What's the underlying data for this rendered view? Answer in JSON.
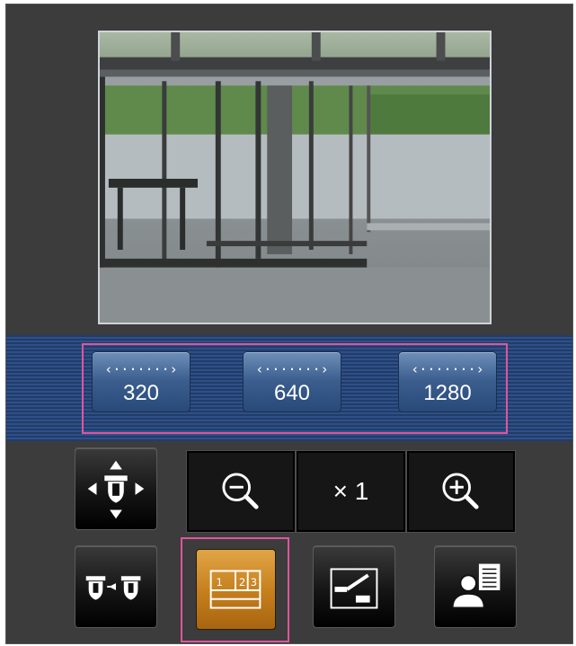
{
  "camera": {
    "feed_description": "",
    "colors": {
      "highlight": "#e0559c",
      "resolution_bar": "#2e5089",
      "active_button": "#d08a28"
    }
  },
  "resolution": {
    "buttons": [
      {
        "icon": "arrow-left-right-icon",
        "label": "320"
      },
      {
        "icon": "arrow-left-right-icon",
        "label": "640"
      },
      {
        "icon": "arrow-left-right-icon",
        "label": "1280"
      }
    ]
  },
  "controls": {
    "pan_tilt_icon": "pan-tilt-icon",
    "zoom_out_icon": "zoom-out-icon",
    "zoom_level": "× 1",
    "zoom_in_icon": "zoom-in-icon",
    "camera_switch_icon": "camera-switch-icon",
    "multi_screen_icon": "multi-screen-icon",
    "multi_screen_numbers": [
      "1",
      "2",
      "3"
    ],
    "edit_icon": "edit-icon",
    "user_list_icon": "user-list-icon"
  }
}
